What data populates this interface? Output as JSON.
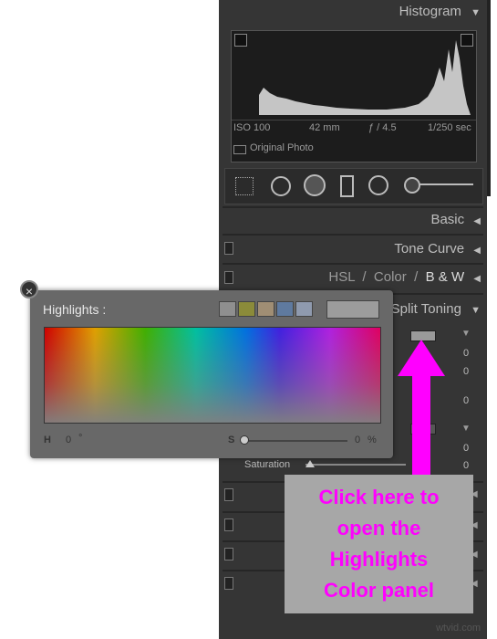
{
  "panel": {
    "histogram_title": "Histogram",
    "iso": "ISO 100",
    "focal": "42 mm",
    "aperture": "ƒ / 4.5",
    "shutter": "1/250 sec",
    "original_photo": "Original Photo",
    "basic": "Basic",
    "tone_curve": "Tone Curve",
    "hsl": "HSL",
    "color": "Color",
    "bw": "B & W",
    "split_toning": "Split Toning",
    "saturation": "Saturation",
    "sat_value": "0",
    "values": [
      "0",
      "0",
      "0",
      "0",
      "0"
    ]
  },
  "popup": {
    "title": "Highlights :",
    "h_label": "H",
    "h_value": "0",
    "h_unit": "°",
    "s_label": "S",
    "s_value": "0",
    "s_unit": "%",
    "presets": [
      "#8f8f8f",
      "#8b8b3a",
      "#a08e74",
      "#5f7a9f",
      "#8f9aae"
    ]
  },
  "callout": {
    "line1": "Click here to",
    "line2": "open the",
    "line3": "Highlights",
    "line4": "Color panel"
  },
  "watermark": "wtvid.com",
  "colors": {
    "accent": "#ff00ff",
    "panel": "#353535",
    "popup": "#686868"
  }
}
